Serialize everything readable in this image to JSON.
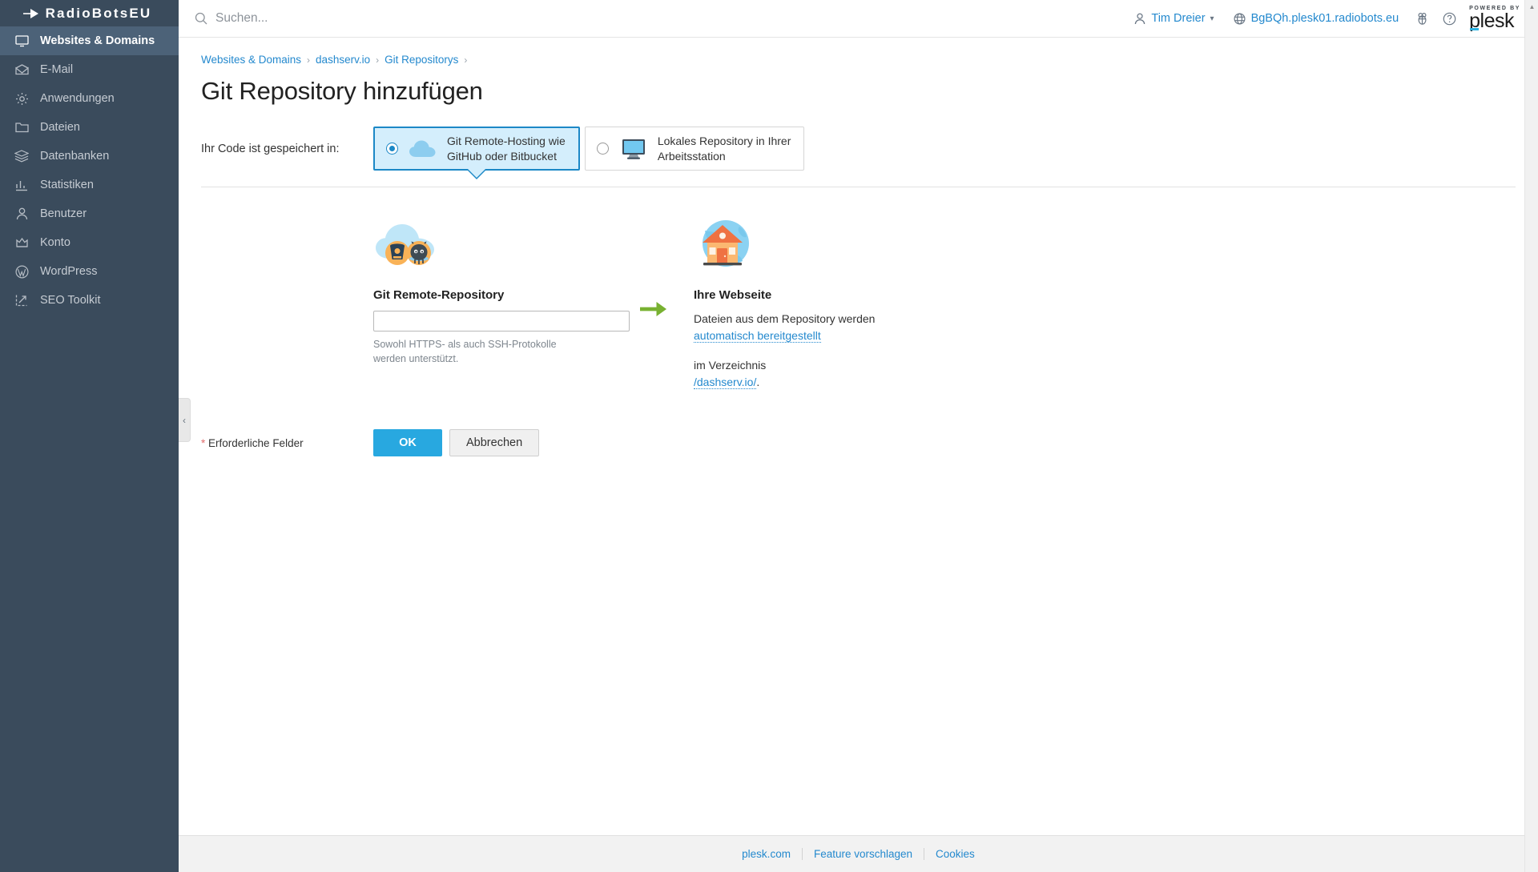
{
  "sidebar": {
    "brand": "RadioBotsEU",
    "brand_icon": "arrow-logo-icon",
    "items": [
      {
        "label": "Websites & Domains",
        "icon": "monitor-icon",
        "active": true
      },
      {
        "label": "E-Mail",
        "icon": "envelope-icon",
        "active": false
      },
      {
        "label": "Anwendungen",
        "icon": "gear-icon",
        "active": false
      },
      {
        "label": "Dateien",
        "icon": "folder-icon",
        "active": false
      },
      {
        "label": "Datenbanken",
        "icon": "database-stack-icon",
        "active": false
      },
      {
        "label": "Statistiken",
        "icon": "bar-chart-icon",
        "active": false
      },
      {
        "label": "Benutzer",
        "icon": "user-icon",
        "active": false
      },
      {
        "label": "Konto",
        "icon": "crown-icon",
        "active": false
      },
      {
        "label": "WordPress",
        "icon": "wordpress-icon",
        "active": false
      },
      {
        "label": "SEO Toolkit",
        "icon": "seo-arrow-icon",
        "active": false
      }
    ],
    "collapse_handle_icon": "chevron-left-icon"
  },
  "topbar": {
    "search_placeholder": "Suchen...",
    "search_value": "",
    "search_icon": "search-icon",
    "user_name": "Tim Dreier",
    "user_icon": "user-icon",
    "user_caret_icon": "chevron-down-icon",
    "server_host": "BgBQh.plesk01.radiobots.eu",
    "server_icon": "globe-icon",
    "bug_icon": "bug-icon",
    "help_icon": "question-circle-icon",
    "plesk_powered": "POWERED BY",
    "plesk_word": "plesk"
  },
  "breadcrumb": {
    "items": [
      "Websites & Domains",
      "dashserv.io",
      "Git Repositorys"
    ],
    "separator": "›"
  },
  "page": {
    "title": "Git Repository hinzufügen"
  },
  "selector": {
    "label": "Ihr Code ist gespeichert in:",
    "options": [
      {
        "line1": "Git Remote-Hosting wie",
        "line2": "GitHub oder Bitbucket",
        "icon": "cloud-icon",
        "selected": true
      },
      {
        "line1": "Lokales Repository in Ihrer",
        "line2": "Arbeitsstation",
        "icon": "desktop-monitor-icon",
        "selected": false
      }
    ]
  },
  "diagram": {
    "left": {
      "image_icon": "cloud-with-git-providers-icon",
      "heading": "Git Remote-Repository",
      "input_value": "",
      "input_placeholder": "",
      "hint": "Sowohl HTTPS- als auch SSH-Protokolle werden unterstützt."
    },
    "arrow_icon": "arrow-right-icon",
    "right": {
      "image_icon": "house-globe-icon",
      "heading": "Ihre Webseite",
      "paragraph1_text": "Dateien aus dem Repository werden",
      "paragraph1_link": "automatisch bereitgestellt",
      "paragraph2_text": "im Verzeichnis",
      "paragraph2_link": "/dashserv.io/",
      "paragraph2_suffix": "."
    }
  },
  "actions": {
    "required_star": "*",
    "required_label": "Erforderliche Felder",
    "ok_label": "OK",
    "cancel_label": "Abbrechen"
  },
  "footer": {
    "links": [
      "plesk.com",
      "Feature vorschlagen",
      "Cookies"
    ]
  },
  "colors": {
    "sidebar_bg": "#3a4b5c",
    "sidebar_active": "#4c6278",
    "accent_blue": "#2489ce",
    "primary_button": "#28a8e0",
    "card_selected_bg": "#d4eefc",
    "card_selected_border": "#1c88c6",
    "arrow_green": "#78b131",
    "required_star": "#e06b6b"
  }
}
